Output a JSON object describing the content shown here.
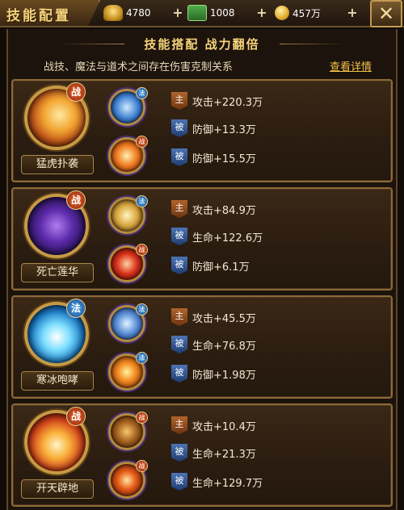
{
  "header": {
    "title": "技能配置",
    "resources": [
      {
        "icon": "ingot-icon",
        "value": "4780"
      },
      {
        "icon": "cash-icon",
        "value": "1008"
      },
      {
        "icon": "coin-icon",
        "value": "457万"
      }
    ],
    "close_icon": "close-icon"
  },
  "panel": {
    "subtitle": "技能搭配 战力翻倍",
    "description": "战技、魔法与道术之间存在伤害克制关系",
    "detail_link": "查看详情"
  },
  "skills": [
    {
      "name": "猛虎扑袭",
      "type_badge": "战",
      "subs": [
        {
          "badge": "法"
        },
        {
          "badge": "战"
        }
      ],
      "stats": [
        {
          "tag": "主",
          "text": "攻击+220.3万"
        },
        {
          "tag": "被",
          "text": "防御+13.3万"
        },
        {
          "tag": "被",
          "text": "防御+15.5万"
        }
      ]
    },
    {
      "name": "死亡莲华",
      "type_badge": "战",
      "subs": [
        {
          "badge": "法"
        },
        {
          "badge": "战"
        }
      ],
      "stats": [
        {
          "tag": "主",
          "text": "攻击+84.9万"
        },
        {
          "tag": "被",
          "text": "生命+122.6万"
        },
        {
          "tag": "被",
          "text": "防御+6.1万"
        }
      ]
    },
    {
      "name": "寒冰咆哮",
      "type_badge": "法",
      "subs": [
        {
          "badge": "法"
        },
        {
          "badge": "法"
        }
      ],
      "stats": [
        {
          "tag": "主",
          "text": "攻击+45.5万"
        },
        {
          "tag": "被",
          "text": "生命+76.8万"
        },
        {
          "tag": "被",
          "text": "防御+1.98万"
        }
      ]
    },
    {
      "name": "开天辟地",
      "type_badge": "战",
      "subs": [
        {
          "badge": "战"
        },
        {
          "badge": "战"
        }
      ],
      "stats": [
        {
          "tag": "主",
          "text": "攻击+10.4万"
        },
        {
          "tag": "被",
          "text": "生命+21.3万"
        },
        {
          "tag": "被",
          "text": "生命+129.7万"
        }
      ]
    }
  ]
}
